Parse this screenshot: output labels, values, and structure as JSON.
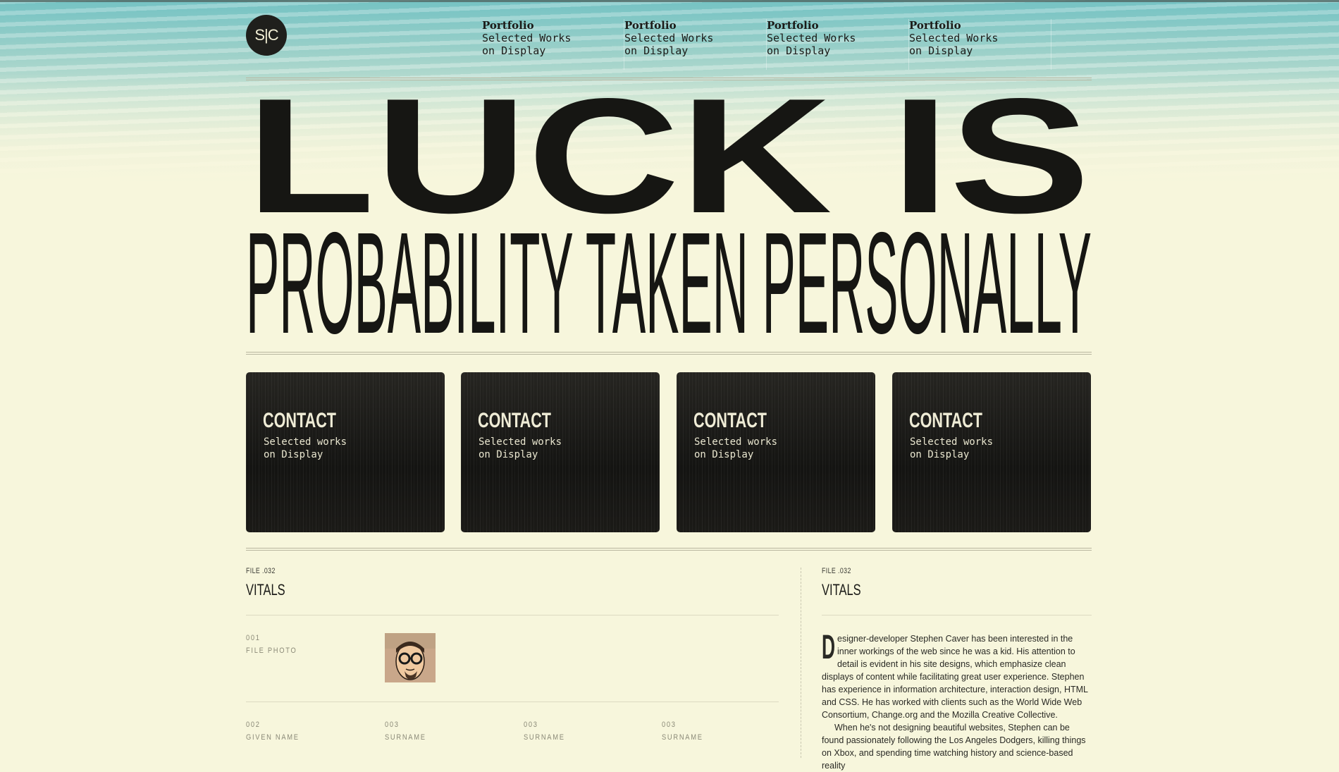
{
  "logo": {
    "text": "S|C"
  },
  "nav": [
    {
      "title": "Portfolio",
      "line1": "Selected Works",
      "line2": "on Display"
    },
    {
      "title": "Portfolio",
      "line1": "Selected Works",
      "line2": "on Display"
    },
    {
      "title": "Portfolio",
      "line1": "Selected Works",
      "line2": "on Display"
    },
    {
      "title": "Portfolio",
      "line1": "Selected Works",
      "line2": "on Display"
    }
  ],
  "hero": {
    "line1": "LUCK IS",
    "line2": "PROBABILITY TAKEN PERSONALLY"
  },
  "cards": [
    {
      "title": "CONTACT",
      "line1": "Selected works",
      "line2": "on Display"
    },
    {
      "title": "CONTACT",
      "line1": "Selected works",
      "line2": "on Display"
    },
    {
      "title": "CONTACT",
      "line1": "Selected works",
      "line2": "on Display"
    },
    {
      "title": "CONTACT",
      "line1": "Selected works",
      "line2": "on Display"
    }
  ],
  "left_section": {
    "file": "FILE .032",
    "title": "VITALS"
  },
  "right_section": {
    "file": "FILE .032",
    "title": "VITALS"
  },
  "fields": {
    "photo": {
      "num": "001",
      "label": "FILE PHOTO"
    },
    "given": {
      "num": "002",
      "label": "GIVEN NAME"
    },
    "surname1": {
      "num": "003",
      "label": "SURNAME"
    },
    "surname2": {
      "num": "003",
      "label": "SURNAME"
    },
    "surname3": {
      "num": "003",
      "label": "SURNAME"
    }
  },
  "bio": {
    "dropcap": "D",
    "p1": "esigner-developer Stephen Caver has been interested in the inner workings of the web since he was a kid. His attention to detail is evident in his site designs, which emphasize clean displays of content while facilitating great user experience. Stephen has experience in information architecture, interaction design, HTML and CSS. He has worked with clients such as the World Wide Web Consortium, Change.org and the Mozilla Creative Collective.",
    "p2": "When he's not designing beautiful websites, Stephen can be found passionately following the Los Angeles Dodgers, killing things on Xbox, and spending time watching history and science-based reality"
  },
  "colors": {
    "ink": "#1b1b18",
    "paper": "#f7f6dc",
    "sky": "#74c3c4"
  }
}
